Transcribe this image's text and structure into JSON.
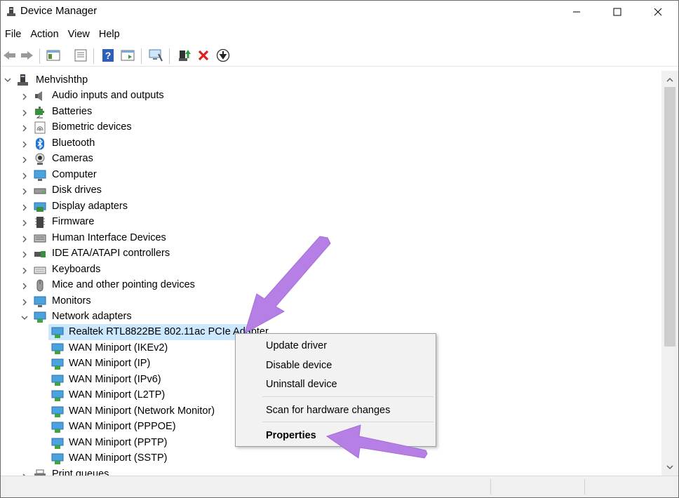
{
  "window": {
    "title": "Device Manager",
    "controls": {
      "minimize": "minimize",
      "maximize": "maximize",
      "close": "close"
    }
  },
  "menu": [
    "File",
    "Action",
    "View",
    "Help"
  ],
  "toolbar": {
    "buttons": [
      "back-icon",
      "forward-icon",
      "show-hide-console-tree-icon",
      "properties-sheet-icon",
      "help-icon",
      "action-pane-icon",
      "scan-hardware-icon",
      "update-driver-icon",
      "uninstall-icon",
      "disable-device-icon"
    ]
  },
  "tree": {
    "root": "Mehvishthp",
    "categories": [
      "Audio inputs and outputs",
      "Batteries",
      "Biometric devices",
      "Bluetooth",
      "Cameras",
      "Computer",
      "Disk drives",
      "Display adapters",
      "Firmware",
      "Human Interface Devices",
      "IDE ATA/ATAPI controllers",
      "Keyboards",
      "Mice and other pointing devices",
      "Monitors",
      "Network adapters"
    ],
    "network_children": [
      "Realtek RTL8822BE 802.11ac PCIe Adapter",
      "WAN Miniport (IKEv2)",
      "WAN Miniport (IP)",
      "WAN Miniport (IPv6)",
      "WAN Miniport (L2TP)",
      "WAN Miniport (Network Monitor)",
      "WAN Miniport (PPPOE)",
      "WAN Miniport (PPTP)",
      "WAN Miniport (SSTP)"
    ],
    "after": "Print queues",
    "selected": "Realtek RTL8822BE 802.11ac PCIe Adapter"
  },
  "context_menu": {
    "items": [
      "Update driver",
      "Disable device",
      "Uninstall device",
      "Scan for hardware changes",
      "Properties"
    ]
  },
  "colors": {
    "selection": "#cce8ff",
    "annotation_arrow": "#b57fe6"
  }
}
